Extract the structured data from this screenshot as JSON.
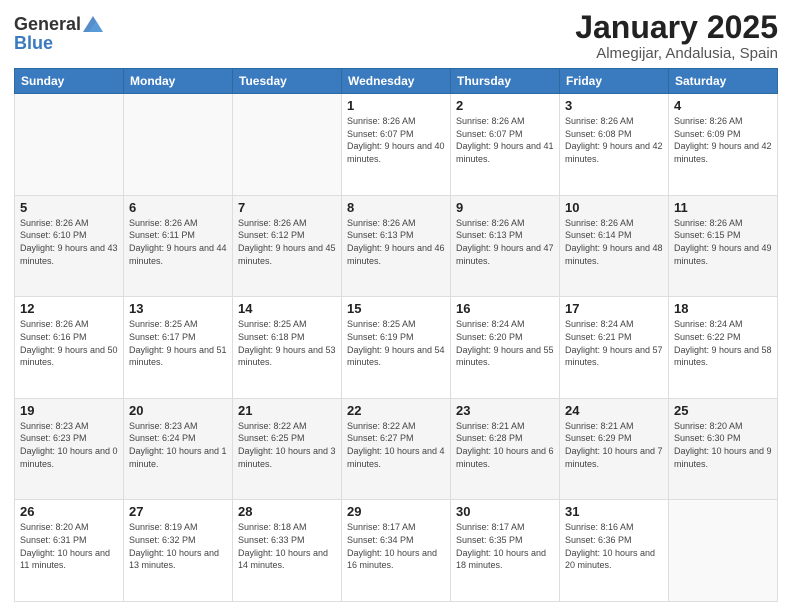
{
  "logo": {
    "general": "General",
    "blue": "Blue"
  },
  "header": {
    "title": "January 2025",
    "subtitle": "Almegijar, Andalusia, Spain"
  },
  "days_of_week": [
    "Sunday",
    "Monday",
    "Tuesday",
    "Wednesday",
    "Thursday",
    "Friday",
    "Saturday"
  ],
  "weeks": [
    [
      {
        "day": "",
        "info": ""
      },
      {
        "day": "",
        "info": ""
      },
      {
        "day": "",
        "info": ""
      },
      {
        "day": "1",
        "info": "Sunrise: 8:26 AM\nSunset: 6:07 PM\nDaylight: 9 hours and 40 minutes."
      },
      {
        "day": "2",
        "info": "Sunrise: 8:26 AM\nSunset: 6:07 PM\nDaylight: 9 hours and 41 minutes."
      },
      {
        "day": "3",
        "info": "Sunrise: 8:26 AM\nSunset: 6:08 PM\nDaylight: 9 hours and 42 minutes."
      },
      {
        "day": "4",
        "info": "Sunrise: 8:26 AM\nSunset: 6:09 PM\nDaylight: 9 hours and 42 minutes."
      }
    ],
    [
      {
        "day": "5",
        "info": "Sunrise: 8:26 AM\nSunset: 6:10 PM\nDaylight: 9 hours and 43 minutes."
      },
      {
        "day": "6",
        "info": "Sunrise: 8:26 AM\nSunset: 6:11 PM\nDaylight: 9 hours and 44 minutes."
      },
      {
        "day": "7",
        "info": "Sunrise: 8:26 AM\nSunset: 6:12 PM\nDaylight: 9 hours and 45 minutes."
      },
      {
        "day": "8",
        "info": "Sunrise: 8:26 AM\nSunset: 6:13 PM\nDaylight: 9 hours and 46 minutes."
      },
      {
        "day": "9",
        "info": "Sunrise: 8:26 AM\nSunset: 6:13 PM\nDaylight: 9 hours and 47 minutes."
      },
      {
        "day": "10",
        "info": "Sunrise: 8:26 AM\nSunset: 6:14 PM\nDaylight: 9 hours and 48 minutes."
      },
      {
        "day": "11",
        "info": "Sunrise: 8:26 AM\nSunset: 6:15 PM\nDaylight: 9 hours and 49 minutes."
      }
    ],
    [
      {
        "day": "12",
        "info": "Sunrise: 8:26 AM\nSunset: 6:16 PM\nDaylight: 9 hours and 50 minutes."
      },
      {
        "day": "13",
        "info": "Sunrise: 8:25 AM\nSunset: 6:17 PM\nDaylight: 9 hours and 51 minutes."
      },
      {
        "day": "14",
        "info": "Sunrise: 8:25 AM\nSunset: 6:18 PM\nDaylight: 9 hours and 53 minutes."
      },
      {
        "day": "15",
        "info": "Sunrise: 8:25 AM\nSunset: 6:19 PM\nDaylight: 9 hours and 54 minutes."
      },
      {
        "day": "16",
        "info": "Sunrise: 8:24 AM\nSunset: 6:20 PM\nDaylight: 9 hours and 55 minutes."
      },
      {
        "day": "17",
        "info": "Sunrise: 8:24 AM\nSunset: 6:21 PM\nDaylight: 9 hours and 57 minutes."
      },
      {
        "day": "18",
        "info": "Sunrise: 8:24 AM\nSunset: 6:22 PM\nDaylight: 9 hours and 58 minutes."
      }
    ],
    [
      {
        "day": "19",
        "info": "Sunrise: 8:23 AM\nSunset: 6:23 PM\nDaylight: 10 hours and 0 minutes."
      },
      {
        "day": "20",
        "info": "Sunrise: 8:23 AM\nSunset: 6:24 PM\nDaylight: 10 hours and 1 minute."
      },
      {
        "day": "21",
        "info": "Sunrise: 8:22 AM\nSunset: 6:25 PM\nDaylight: 10 hours and 3 minutes."
      },
      {
        "day": "22",
        "info": "Sunrise: 8:22 AM\nSunset: 6:27 PM\nDaylight: 10 hours and 4 minutes."
      },
      {
        "day": "23",
        "info": "Sunrise: 8:21 AM\nSunset: 6:28 PM\nDaylight: 10 hours and 6 minutes."
      },
      {
        "day": "24",
        "info": "Sunrise: 8:21 AM\nSunset: 6:29 PM\nDaylight: 10 hours and 7 minutes."
      },
      {
        "day": "25",
        "info": "Sunrise: 8:20 AM\nSunset: 6:30 PM\nDaylight: 10 hours and 9 minutes."
      }
    ],
    [
      {
        "day": "26",
        "info": "Sunrise: 8:20 AM\nSunset: 6:31 PM\nDaylight: 10 hours and 11 minutes."
      },
      {
        "day": "27",
        "info": "Sunrise: 8:19 AM\nSunset: 6:32 PM\nDaylight: 10 hours and 13 minutes."
      },
      {
        "day": "28",
        "info": "Sunrise: 8:18 AM\nSunset: 6:33 PM\nDaylight: 10 hours and 14 minutes."
      },
      {
        "day": "29",
        "info": "Sunrise: 8:17 AM\nSunset: 6:34 PM\nDaylight: 10 hours and 16 minutes."
      },
      {
        "day": "30",
        "info": "Sunrise: 8:17 AM\nSunset: 6:35 PM\nDaylight: 10 hours and 18 minutes."
      },
      {
        "day": "31",
        "info": "Sunrise: 8:16 AM\nSunset: 6:36 PM\nDaylight: 10 hours and 20 minutes."
      },
      {
        "day": "",
        "info": ""
      }
    ]
  ]
}
